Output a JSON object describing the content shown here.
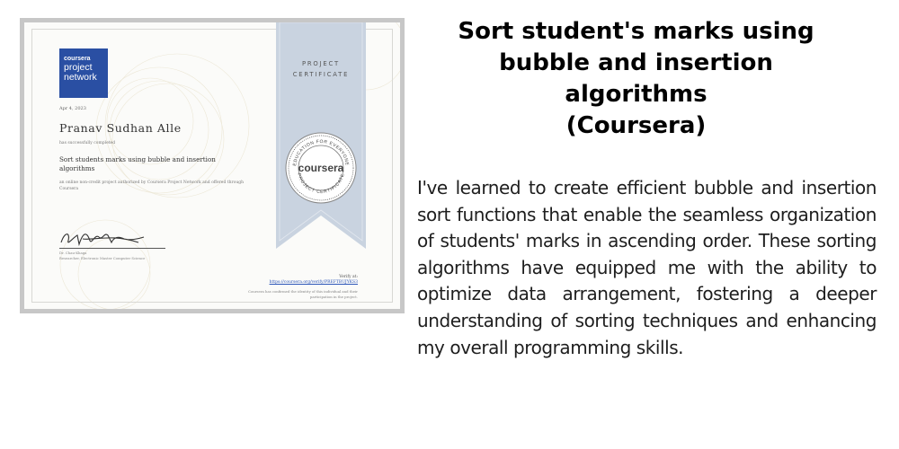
{
  "certificate": {
    "logo": {
      "brand": "coursera",
      "line1": "project",
      "line2": "network"
    },
    "date": "Apr 4, 2023",
    "recipient_name": "Pranav Sudhan Alle",
    "completed_text": "has successfully completed",
    "course_title": "Sort students marks using bubble and insertion algorithms",
    "description": "an online non-credit project authorized by Coursera Project Network and offered through Coursera",
    "signer": {
      "name": "Dr. Chau-Khaga",
      "title": "Researcher, Electronic Master Computer Science"
    },
    "ribbon": {
      "line1": "PROJECT",
      "line2": "CERTIFICATE"
    },
    "seal": {
      "ring_top": "EDUCATION FOR EVERYONE",
      "ring_bottom": "PROJECT CERTIFICATE",
      "center": "coursera"
    },
    "verify_label": "Verify at:",
    "verify_url": "https://coursera.org/verify/PREFTBUJYKS3",
    "confirm_text": "Coursera has confirmed the identity of this individual and their participation in the project."
  },
  "headline": [
    "Sort student's marks using",
    "bubble and insertion",
    "algorithms",
    "(Coursera)"
  ],
  "body": "I've learned to create efficient bubble and insertion sort functions that enable the seamless organization of students' marks in ascending order. These sorting algorithms have equipped me with the ability to optimize data arrangement, fostering a deeper understanding of sorting techniques and enhancing my overall programming skills.",
  "colors": {
    "logo_blue": "#2a4fa3",
    "ribbon_blue": "#c9d3e0",
    "link_blue": "#2b55b8"
  }
}
